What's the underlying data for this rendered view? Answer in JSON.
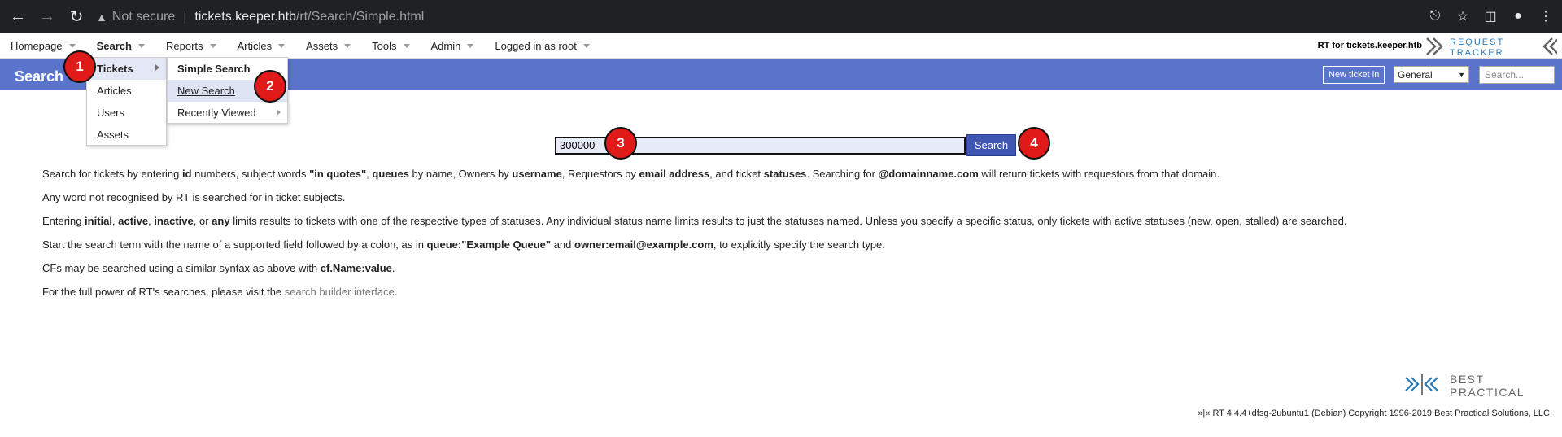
{
  "browser": {
    "security_label": "Not secure",
    "url_host": "tickets.keeper.htb",
    "url_path": "/rt/Search/Simple.html"
  },
  "topmenu": {
    "items": [
      {
        "label": "Homepage"
      },
      {
        "label": "Search"
      },
      {
        "label": "Reports"
      },
      {
        "label": "Articles"
      },
      {
        "label": "Assets"
      },
      {
        "label": "Tools"
      },
      {
        "label": "Admin"
      },
      {
        "label": "Logged in as root"
      }
    ],
    "brand": "RT for tickets.keeper.htb",
    "logo_text": [
      "REQUEST",
      "TRACKER"
    ]
  },
  "header": {
    "title": "Search",
    "new_ticket_label": "New ticket in",
    "queue_selected": "General",
    "search_placeholder": "Search..."
  },
  "search_menu": {
    "items": [
      {
        "label": "Tickets"
      },
      {
        "label": "Articles"
      },
      {
        "label": "Users"
      },
      {
        "label": "Assets"
      }
    ]
  },
  "tickets_submenu": {
    "items": [
      {
        "label": "Simple Search"
      },
      {
        "label": "New Search"
      },
      {
        "label": "Recently Viewed"
      }
    ]
  },
  "badges": [
    "1",
    "2",
    "3",
    "4"
  ],
  "main": {
    "search_value": "300000",
    "search_button": "Search"
  },
  "help": {
    "p1": {
      "a": "Search for tickets by entering ",
      "b1": "id",
      "c": " numbers, subject words ",
      "b2": "\"in quotes\"",
      "d": ", ",
      "b3": "queues",
      "e": " by name, Owners by ",
      "b4": "username",
      "f": ", Requestors by ",
      "b5": "email address",
      "g": ", and ticket ",
      "b6": "statuses",
      "h": ". Searching for ",
      "b7": "@domainname.com",
      "i": " will return tickets with requestors from that domain."
    },
    "p2": "Any word not recognised by RT is searched for in ticket subjects.",
    "p3": {
      "a": "Entering ",
      "b1": "initial",
      "c": ", ",
      "b2": "active",
      "d": ", ",
      "b3": "inactive",
      "e": ", or ",
      "b4": "any",
      "f": " limits results to tickets with one of the respective types of statuses. Any individual status name limits results to just the statuses named. Unless you specify a specific status, only tickets with active statuses (new, open, stalled) are searched."
    },
    "p4": {
      "a": "Start the search term with the name of a supported field followed by a colon, as in ",
      "b1": "queue:\"Example Queue\"",
      "c": " and ",
      "b2": "owner:email@example.com",
      "d": ", to explicitly specify the search type."
    },
    "p5": {
      "a": "CFs may be searched using a similar syntax as above with ",
      "b1": "cf.Name:value",
      "c": "."
    },
    "p6": {
      "a": "For the full power of RT's searches, please visit the ",
      "link": "search builder interface",
      "c": "."
    }
  },
  "footer": {
    "logo_text": [
      "BEST",
      "PRACTICAL"
    ],
    "copyright": "»|« RT 4.4.4+dfsg-2ubuntu1 (Debian) Copyright 1996-2019 Best Practical Solutions, LLC."
  },
  "colors": {
    "header_blue": "#5b74cb",
    "button_blue": "#3f56b2",
    "badge_red": "#e01919"
  }
}
